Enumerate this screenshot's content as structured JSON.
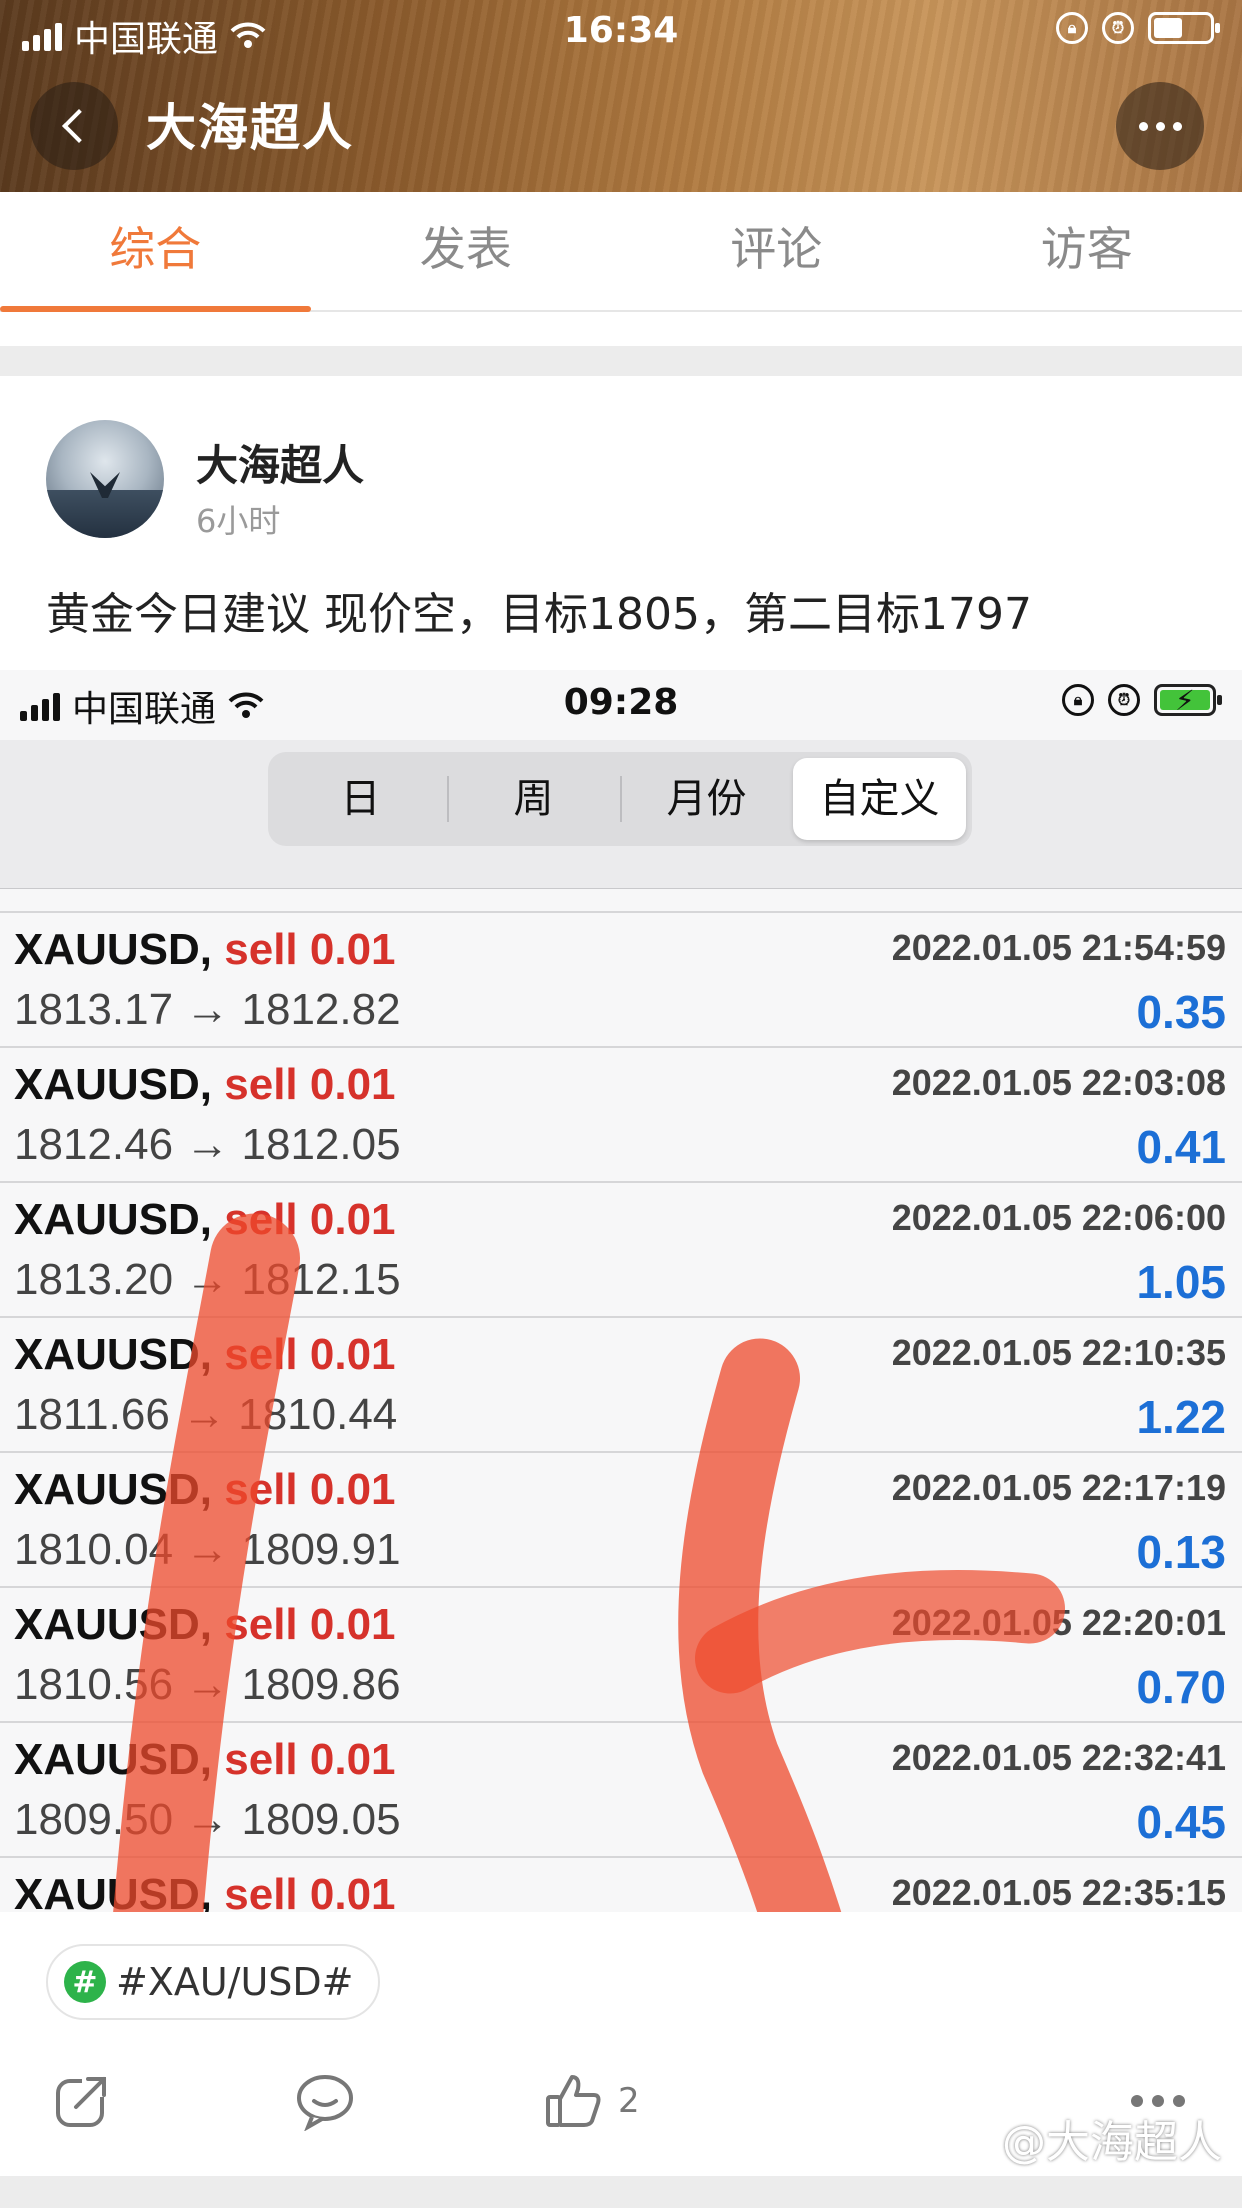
{
  "status_bar": {
    "carrier": "中国联通",
    "time": "16:34"
  },
  "header": {
    "title": "大海超人"
  },
  "tabs": [
    {
      "label": "综合"
    },
    {
      "label": "发表"
    },
    {
      "label": "评论"
    },
    {
      "label": "访客"
    }
  ],
  "post": {
    "author": "大海超人",
    "time": "6小时",
    "text": "黄金今日建议 现价空，目标1805，第二目标1797"
  },
  "embedded": {
    "status_bar": {
      "carrier": "中国联通",
      "time": "09:28"
    },
    "segments": [
      "日",
      "周",
      "月份",
      "自定义"
    ],
    "trades": [
      {
        "symbol": "XAUUSD,",
        "side": "sell 0.01",
        "datetime": "2022.01.05 21:54:59",
        "prices": "1813.17 → 1812.82",
        "profit": "0.35"
      },
      {
        "symbol": "XAUUSD,",
        "side": "sell 0.01",
        "datetime": "2022.01.05 22:03:08",
        "prices": "1812.46 → 1812.05",
        "profit": "0.41"
      },
      {
        "symbol": "XAUUSD,",
        "side": "sell 0.01",
        "datetime": "2022.01.05 22:06:00",
        "prices": "1813.20 → 1812.15",
        "profit": "1.05"
      },
      {
        "symbol": "XAUUSD,",
        "side": "sell 0.01",
        "datetime": "2022.01.05 22:10:35",
        "prices": "1811.66 → 1810.44",
        "profit": "1.22"
      },
      {
        "symbol": "XAUUSD,",
        "side": "sell 0.01",
        "datetime": "2022.01.05 22:17:19",
        "prices": "1810.04 → 1809.91",
        "profit": "0.13"
      },
      {
        "symbol": "XAUUSD,",
        "side": "sell 0.01",
        "datetime": "2022.01.05 22:20:01",
        "prices": "1810.56 → 1809.86",
        "profit": "0.70"
      },
      {
        "symbol": "XAUUSD,",
        "side": "sell 0.01",
        "datetime": "2022.01.05 22:32:41",
        "prices": "1809.50 → 1809.05",
        "profit": "0.45"
      },
      {
        "symbol": "XAUUSD,",
        "side": "sell 0.01",
        "datetime": "2022.01.05 22:35:15",
        "prices": "",
        "profit": ""
      }
    ]
  },
  "topic_tag": "#XAU/USD#",
  "actions": {
    "like_count": "2"
  },
  "watermark": "@大海超人",
  "colors": {
    "accent": "#f0793a",
    "sell": "#d6322b",
    "profit": "#1c6fd6",
    "topic": "#2db34a"
  }
}
